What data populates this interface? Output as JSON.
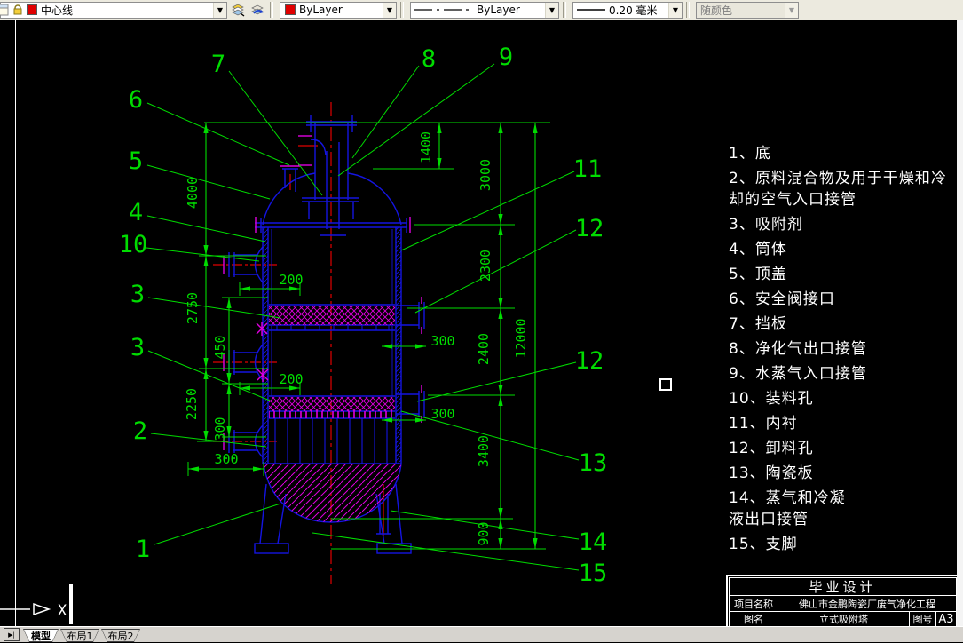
{
  "toolbar": {
    "layer_name": "中心线",
    "color_value": "ByLayer",
    "linetype_value": "ByLayer",
    "lineweight_value": "0.20 毫米",
    "plot_style_value": "随颜色"
  },
  "drawing": {
    "dims": {
      "r1400": "1400",
      "r3000": "3000",
      "r2300": "2300",
      "r2400": "2400",
      "r3400": "3400",
      "r900": "900",
      "r12000": "12000",
      "l4000": "4000",
      "l2750": "2750",
      "l2250": "2250",
      "l450": "450",
      "l300": "300",
      "h200a": "200",
      "h200b": "200",
      "h300a": "300",
      "h300b": "300",
      "h300c": "300"
    },
    "callouts": {
      "c1": "1",
      "c2": "2",
      "c3a": "3",
      "c3b": "3",
      "c4": "4",
      "c5": "5",
      "c6": "6",
      "c7": "7",
      "c8": "8",
      "c9": "9",
      "c10": "10",
      "c11": "11",
      "c12a": "12",
      "c12b": "12",
      "c13": "13",
      "c14": "14",
      "c15": "15"
    }
  },
  "parts_list": {
    "items": [
      "1、底",
      "2、原料混合物及用于干燥和冷\n却的空气入口接管",
      "3、吸附剂",
      "4、筒体",
      "5、顶盖",
      "6、安全阀接口",
      "7、挡板",
      "8、净化气出口接管",
      "9、水蒸气入口接管",
      "10、装料孔",
      "11、内衬",
      "12、卸料孔",
      "13、陶瓷板",
      "14、蒸气和冷凝\n液出口接管",
      "15、支脚"
    ]
  },
  "title_block": {
    "title": "毕业设计",
    "project_label": "项目名称",
    "project_value": "佛山市金鹏陶瓷厂废气净化工程",
    "drawing_label": "图名",
    "drawing_value": "立式吸附塔",
    "no_label": "图号",
    "no_value": "A3"
  },
  "status_bar": {
    "tabs": [
      "模型",
      "布局1",
      "布局2"
    ],
    "nav_icon": "▶|"
  },
  "ucs": {
    "x_label": "X"
  },
  "colors": {
    "canvas": "#000000",
    "entity_blue": "#1414e0",
    "centerline_red": "#df0000",
    "dimension_green": "#00dc00",
    "hatch_magenta": "#df00df",
    "text_white": "#ffffff"
  }
}
